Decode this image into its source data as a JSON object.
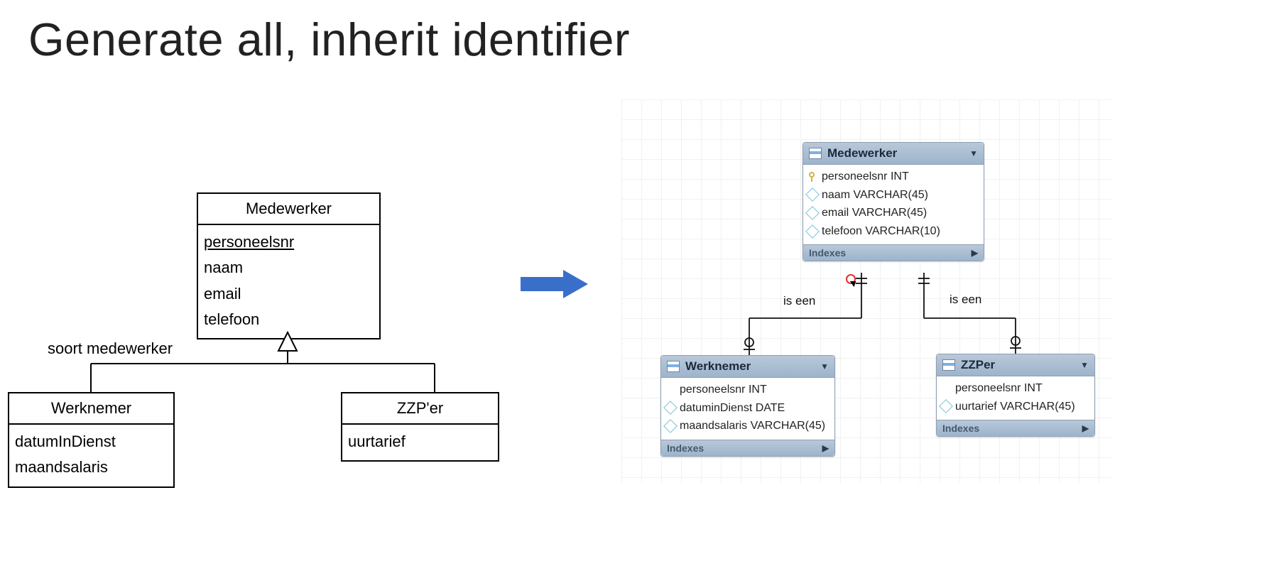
{
  "title": "Generate all, inherit identifier",
  "uml": {
    "parent": {
      "name": "Medewerker",
      "attributes": [
        "personeelsnr",
        "naam",
        "email",
        "telefoon"
      ],
      "pk": "personeelsnr"
    },
    "discriminator_label": "soort medewerker",
    "children": [
      {
        "name": "Werknemer",
        "attributes": [
          "datumInDienst",
          "maandsalaris"
        ]
      },
      {
        "name": "ZZP'er",
        "attributes": [
          "uurtarief"
        ]
      }
    ]
  },
  "db": {
    "relation_label": "is een",
    "indexes_label": "Indexes",
    "tables": [
      {
        "name": "Medewerker",
        "columns": [
          {
            "name": "personeelsnr",
            "type": "INT",
            "pk": true
          },
          {
            "name": "naam",
            "type": "VARCHAR(45)",
            "pk": false
          },
          {
            "name": "email",
            "type": "VARCHAR(45)",
            "pk": false
          },
          {
            "name": "telefoon",
            "type": "VARCHAR(10)",
            "pk": false
          }
        ]
      },
      {
        "name": "Werknemer",
        "columns": [
          {
            "name": "personeelsnr",
            "type": "INT",
            "pk": false,
            "noicon": true
          },
          {
            "name": "datuminDienst",
            "type": "DATE",
            "pk": false
          },
          {
            "name": "maandsalaris",
            "type": "VARCHAR(45)",
            "pk": false
          }
        ]
      },
      {
        "name": "ZZPer",
        "columns": [
          {
            "name": "personeelsnr",
            "type": "INT",
            "pk": false,
            "noicon": true
          },
          {
            "name": "uurtarief",
            "type": "VARCHAR(45)",
            "pk": false
          }
        ]
      }
    ]
  }
}
